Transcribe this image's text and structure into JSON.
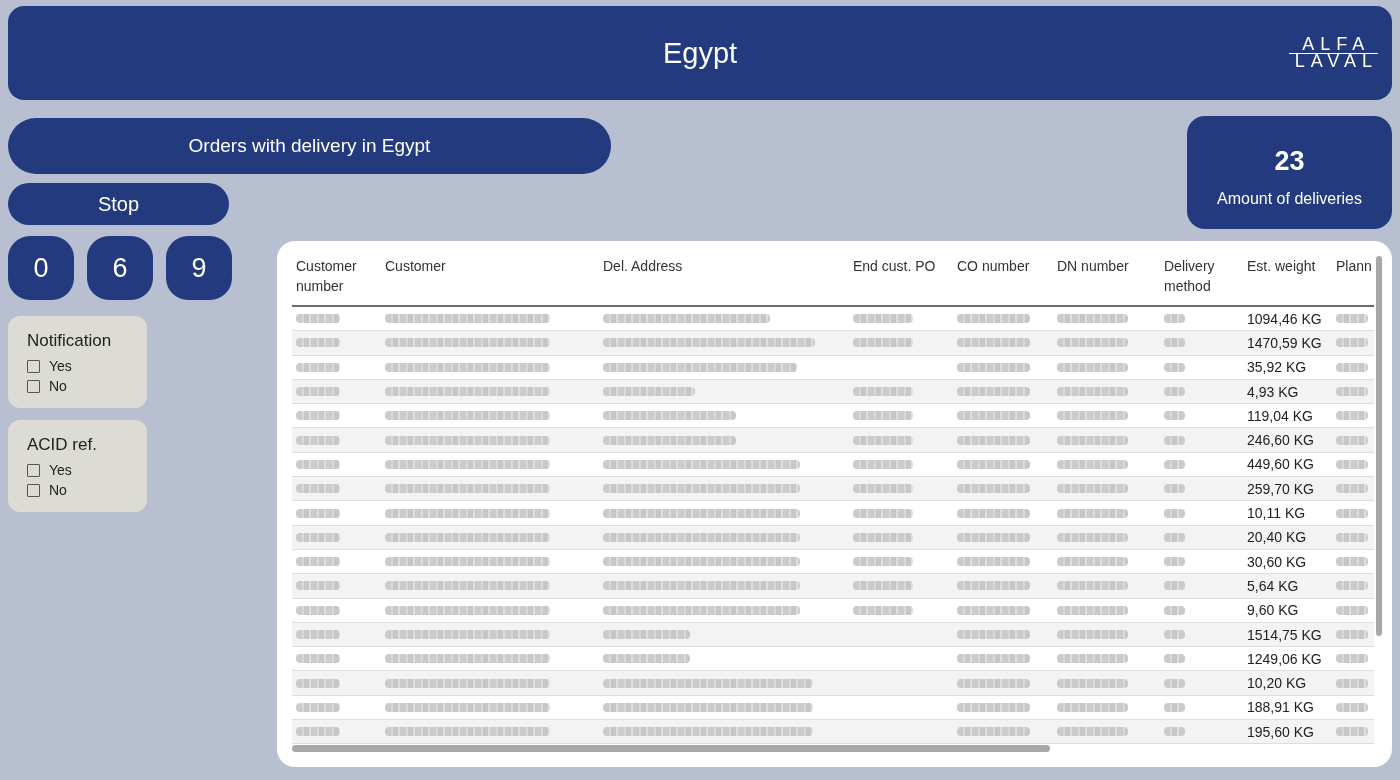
{
  "header": {
    "title": "Egypt",
    "logo": {
      "lines": [
        "ALFA",
        "LAVAL"
      ]
    }
  },
  "banner": {
    "title": "Orders with delivery in Egypt"
  },
  "stop_button": {
    "label": "Stop"
  },
  "timer": {
    "digits": [
      "0",
      "6",
      "9"
    ]
  },
  "filters": [
    {
      "title": "Notification",
      "options": [
        {
          "label": "Yes",
          "checked": false
        },
        {
          "label": "No",
          "checked": false
        }
      ]
    },
    {
      "title": "ACID ref.",
      "options": [
        {
          "label": "Yes",
          "checked": false
        },
        {
          "label": "No",
          "checked": false
        }
      ]
    }
  ],
  "kpi": {
    "value": "23",
    "label": "Amount of deliveries"
  },
  "table": {
    "columns": [
      "Customer number",
      "Customer",
      "Del. Address",
      "End cust. PO",
      "CO number",
      "DN number",
      "Delivery method",
      "Est. weight",
      "Plann"
    ],
    "rows": [
      {
        "cells": [
          {
            "kind": "redacted"
          },
          {
            "kind": "redacted"
          },
          {
            "kind": "redacted"
          },
          {
            "kind": "redacted"
          },
          {
            "kind": "redacted"
          },
          {
            "kind": "redacted"
          },
          {
            "kind": "redacted"
          },
          {
            "kind": "text",
            "text": "1094,46 KG"
          },
          {
            "kind": "redacted"
          }
        ]
      },
      {
        "cells": [
          {
            "kind": "redacted"
          },
          {
            "kind": "redacted"
          },
          {
            "kind": "redacted"
          },
          {
            "kind": "redacted"
          },
          {
            "kind": "redacted"
          },
          {
            "kind": "redacted"
          },
          {
            "kind": "redacted"
          },
          {
            "kind": "text",
            "text": "1470,59 KG"
          },
          {
            "kind": "redacted"
          }
        ]
      },
      {
        "cells": [
          {
            "kind": "redacted"
          },
          {
            "kind": "redacted"
          },
          {
            "kind": "redacted"
          },
          {
            "kind": "empty"
          },
          {
            "kind": "redacted"
          },
          {
            "kind": "redacted"
          },
          {
            "kind": "redacted"
          },
          {
            "kind": "text",
            "text": "35,92 KG"
          },
          {
            "kind": "redacted"
          }
        ]
      },
      {
        "cells": [
          {
            "kind": "redacted"
          },
          {
            "kind": "redacted"
          },
          {
            "kind": "redacted"
          },
          {
            "kind": "redacted"
          },
          {
            "kind": "redacted"
          },
          {
            "kind": "redacted"
          },
          {
            "kind": "redacted"
          },
          {
            "kind": "text",
            "text": "4,93 KG"
          },
          {
            "kind": "redacted"
          }
        ]
      },
      {
        "cells": [
          {
            "kind": "redacted"
          },
          {
            "kind": "redacted"
          },
          {
            "kind": "redacted"
          },
          {
            "kind": "redacted"
          },
          {
            "kind": "redacted"
          },
          {
            "kind": "redacted"
          },
          {
            "kind": "redacted"
          },
          {
            "kind": "text",
            "text": "119,04 KG"
          },
          {
            "kind": "redacted"
          }
        ]
      },
      {
        "cells": [
          {
            "kind": "redacted"
          },
          {
            "kind": "redacted"
          },
          {
            "kind": "redacted"
          },
          {
            "kind": "redacted"
          },
          {
            "kind": "redacted"
          },
          {
            "kind": "redacted"
          },
          {
            "kind": "redacted"
          },
          {
            "kind": "text",
            "text": "246,60 KG"
          },
          {
            "kind": "redacted"
          }
        ]
      },
      {
        "cells": [
          {
            "kind": "redacted"
          },
          {
            "kind": "redacted"
          },
          {
            "kind": "redacted"
          },
          {
            "kind": "redacted"
          },
          {
            "kind": "redacted"
          },
          {
            "kind": "redacted"
          },
          {
            "kind": "redacted"
          },
          {
            "kind": "text",
            "text": "449,60 KG"
          },
          {
            "kind": "redacted"
          }
        ]
      },
      {
        "cells": [
          {
            "kind": "redacted"
          },
          {
            "kind": "redacted"
          },
          {
            "kind": "redacted"
          },
          {
            "kind": "redacted"
          },
          {
            "kind": "redacted"
          },
          {
            "kind": "redacted"
          },
          {
            "kind": "redacted"
          },
          {
            "kind": "text",
            "text": "259,70 KG"
          },
          {
            "kind": "redacted"
          }
        ]
      },
      {
        "cells": [
          {
            "kind": "redacted"
          },
          {
            "kind": "redacted"
          },
          {
            "kind": "redacted"
          },
          {
            "kind": "redacted"
          },
          {
            "kind": "redacted"
          },
          {
            "kind": "redacted"
          },
          {
            "kind": "redacted"
          },
          {
            "kind": "text",
            "text": "10,11 KG"
          },
          {
            "kind": "redacted"
          }
        ]
      },
      {
        "cells": [
          {
            "kind": "redacted"
          },
          {
            "kind": "redacted"
          },
          {
            "kind": "redacted"
          },
          {
            "kind": "redacted"
          },
          {
            "kind": "redacted"
          },
          {
            "kind": "redacted"
          },
          {
            "kind": "redacted"
          },
          {
            "kind": "text",
            "text": "20,40 KG"
          },
          {
            "kind": "redacted"
          }
        ]
      },
      {
        "cells": [
          {
            "kind": "redacted"
          },
          {
            "kind": "redacted"
          },
          {
            "kind": "redacted"
          },
          {
            "kind": "redacted"
          },
          {
            "kind": "redacted"
          },
          {
            "kind": "redacted"
          },
          {
            "kind": "redacted"
          },
          {
            "kind": "text",
            "text": "30,60 KG"
          },
          {
            "kind": "redacted"
          }
        ]
      },
      {
        "cells": [
          {
            "kind": "redacted"
          },
          {
            "kind": "redacted"
          },
          {
            "kind": "redacted"
          },
          {
            "kind": "redacted"
          },
          {
            "kind": "redacted"
          },
          {
            "kind": "redacted"
          },
          {
            "kind": "redacted"
          },
          {
            "kind": "text",
            "text": "5,64 KG"
          },
          {
            "kind": "redacted"
          }
        ]
      },
      {
        "cells": [
          {
            "kind": "redacted"
          },
          {
            "kind": "redacted"
          },
          {
            "kind": "redacted"
          },
          {
            "kind": "redacted"
          },
          {
            "kind": "redacted"
          },
          {
            "kind": "redacted"
          },
          {
            "kind": "redacted"
          },
          {
            "kind": "text",
            "text": "9,60 KG"
          },
          {
            "kind": "redacted"
          }
        ]
      },
      {
        "cells": [
          {
            "kind": "redacted"
          },
          {
            "kind": "redacted"
          },
          {
            "kind": "redacted"
          },
          {
            "kind": "empty"
          },
          {
            "kind": "redacted"
          },
          {
            "kind": "redacted"
          },
          {
            "kind": "redacted"
          },
          {
            "kind": "text",
            "text": "1514,75 KG"
          },
          {
            "kind": "redacted"
          }
        ]
      },
      {
        "cells": [
          {
            "kind": "redacted"
          },
          {
            "kind": "redacted"
          },
          {
            "kind": "redacted"
          },
          {
            "kind": "empty"
          },
          {
            "kind": "redacted"
          },
          {
            "kind": "redacted"
          },
          {
            "kind": "redacted"
          },
          {
            "kind": "text",
            "text": "1249,06 KG"
          },
          {
            "kind": "redacted"
          }
        ]
      },
      {
        "cells": [
          {
            "kind": "redacted"
          },
          {
            "kind": "redacted"
          },
          {
            "kind": "redacted"
          },
          {
            "kind": "empty"
          },
          {
            "kind": "redacted"
          },
          {
            "kind": "redacted"
          },
          {
            "kind": "redacted"
          },
          {
            "kind": "text",
            "text": "10,20 KG"
          },
          {
            "kind": "redacted"
          }
        ]
      },
      {
        "cells": [
          {
            "kind": "redacted"
          },
          {
            "kind": "redacted"
          },
          {
            "kind": "redacted"
          },
          {
            "kind": "empty"
          },
          {
            "kind": "redacted"
          },
          {
            "kind": "redacted"
          },
          {
            "kind": "redacted"
          },
          {
            "kind": "text",
            "text": "188,91 KG"
          },
          {
            "kind": "redacted"
          }
        ]
      },
      {
        "cells": [
          {
            "kind": "redacted"
          },
          {
            "kind": "redacted"
          },
          {
            "kind": "redacted"
          },
          {
            "kind": "empty"
          },
          {
            "kind": "redacted"
          },
          {
            "kind": "redacted"
          },
          {
            "kind": "redacted"
          },
          {
            "kind": "text",
            "text": "195,60 KG"
          },
          {
            "kind": "redacted"
          }
        ]
      }
    ]
  }
}
